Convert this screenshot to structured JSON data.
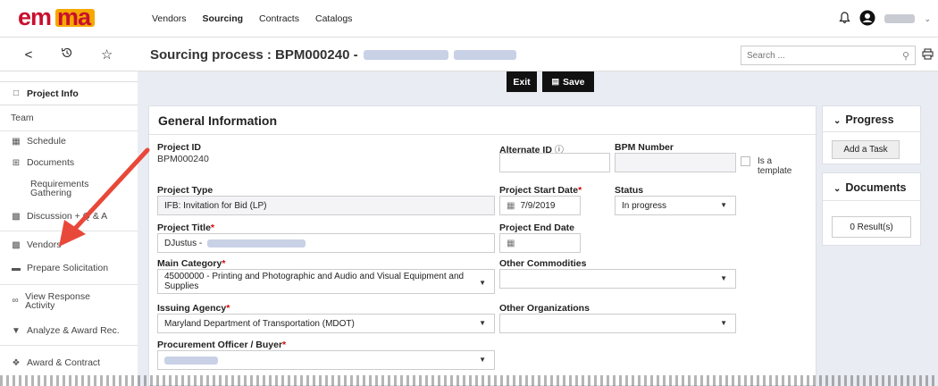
{
  "logo": {
    "text": "emma"
  },
  "nav": {
    "items": [
      "Vendors",
      "Sourcing",
      "Contracts",
      "Catalogs"
    ],
    "active": "Sourcing"
  },
  "user": {
    "icons": [
      "bell-icon",
      "user-icon",
      "chevron-down-icon"
    ]
  },
  "toolbar": {
    "back": "<",
    "history_icon": "history-icon",
    "favorite_icon": "star-icon"
  },
  "page": {
    "title": "Sourcing process : BPM000240 -"
  },
  "search": {
    "placeholder": "Search ..."
  },
  "actions": {
    "exit": "Exit",
    "save": "Save",
    "save_icon": "save-icon"
  },
  "sidebar": {
    "items": [
      {
        "label": "Project Info",
        "icon": "page-icon"
      },
      {
        "label": "Team",
        "icon": ""
      },
      {
        "label": "Schedule",
        "icon": "calendar-icon"
      },
      {
        "label": "Documents",
        "icon": "document-icon"
      },
      {
        "label": "Requirements Gathering",
        "icon": ""
      },
      {
        "label": "Discussion + Q & A",
        "icon": "chat-icon"
      },
      {
        "label": "Vendors",
        "icon": "truck-icon"
      },
      {
        "label": "Prepare Solicitation",
        "icon": "folder-icon"
      },
      {
        "label": "View Response Activity",
        "icon": "binoculars-icon"
      },
      {
        "label": "Analyze & Award Rec.",
        "icon": "trophy-icon"
      },
      {
        "label": "Award & Contract",
        "icon": "handshake-icon"
      }
    ]
  },
  "general": {
    "title": "General Information",
    "project_id": {
      "label": "Project ID",
      "value": "BPM000240"
    },
    "alternate_id": {
      "label": "Alternate ID",
      "value": ""
    },
    "bpm_number": {
      "label": "BPM Number",
      "value": ""
    },
    "is_template": {
      "label": "Is a template"
    },
    "project_type": {
      "label": "Project Type",
      "value": "IFB: Invitation for Bid (LP)"
    },
    "start_date": {
      "label": "Project Start Date",
      "value": "7/9/2019"
    },
    "status": {
      "label": "Status",
      "value": "In progress"
    },
    "project_title": {
      "label": "Project Title",
      "value": "DJustus -"
    },
    "end_date": {
      "label": "Project End Date",
      "value": ""
    },
    "main_category": {
      "label": "Main Category",
      "value": "45000000 - Printing and Photographic and Audio and Visual Equipment and Supplies"
    },
    "other_commodities": {
      "label": "Other Commodities",
      "value": ""
    },
    "issuing_agency": {
      "label": "Issuing Agency",
      "value": "Maryland Department of Transportation (MDOT)"
    },
    "other_orgs": {
      "label": "Other Organizations",
      "value": ""
    },
    "officer": {
      "label": "Procurement Officer / Buyer",
      "value": ""
    }
  },
  "progress": {
    "title": "Progress",
    "add_task": "Add a Task"
  },
  "documents": {
    "title": "Documents",
    "results": "0 Result(s)"
  },
  "colors": {
    "accent": "#111111",
    "required": "#dd0000",
    "arrow": "#e8483a",
    "background": "#e9ecf2"
  }
}
